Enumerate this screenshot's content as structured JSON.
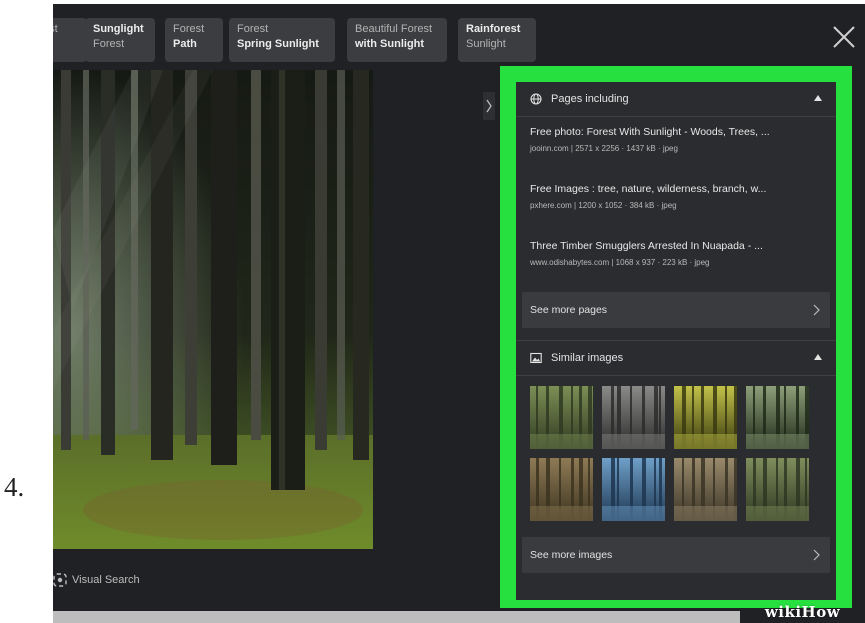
{
  "step": {
    "number": "4."
  },
  "related_searches": [
    {
      "light": "est",
      "bold": "n"
    },
    {
      "bold": "Sunglight",
      "light": "Forest"
    },
    {
      "light": "Forest",
      "bold": "Path"
    },
    {
      "light": "Forest",
      "bold": "Spring Sunlight"
    },
    {
      "light": "Beautiful Forest",
      "bold": "with Sunlight"
    },
    {
      "bold": "Rainforest",
      "light": "Sunlight"
    }
  ],
  "close_icon": "close-x-icon",
  "visual_search": {
    "label": "Visual Search",
    "icon": "lens-icon"
  },
  "pages_including": {
    "title": "Pages including",
    "icon": "globe-icon",
    "items": [
      {
        "title": "Free photo: Forest With Sunlight - Woods, Trees, ...",
        "meta": "jooinn.com | 2571 x 2256 · 1437 kB · jpeg"
      },
      {
        "title": "Free Images : tree, nature, wilderness, branch, w...",
        "meta": "pxhere.com | 1200 x 1052 · 384 kB · jpeg"
      },
      {
        "title": "Three Timber Smugglers Arrested In Nuapada - ...",
        "meta": "www.odishabytes.com | 1068 x 937 · 223 kB · jpeg"
      }
    ],
    "see_more": "See more pages"
  },
  "similar_images": {
    "title": "Similar images",
    "icon": "image-icon",
    "see_more": "See more images",
    "thumb_colors": [
      [
        "#2f3a22",
        "#7c8f55"
      ],
      [
        "#2b2b2b",
        "#8a8a88"
      ],
      [
        "#3a3a10",
        "#c2c24a"
      ],
      [
        "#1f2a18",
        "#8d9f7a"
      ],
      [
        "#3c3420",
        "#8f7a55"
      ],
      [
        "#1d3550",
        "#6fa0c8"
      ],
      [
        "#3a3426",
        "#9a8a6c"
      ],
      [
        "#2e3622",
        "#7f8e5c"
      ]
    ]
  },
  "highlight_color": "#26e03f",
  "watermark": "wikiHow"
}
